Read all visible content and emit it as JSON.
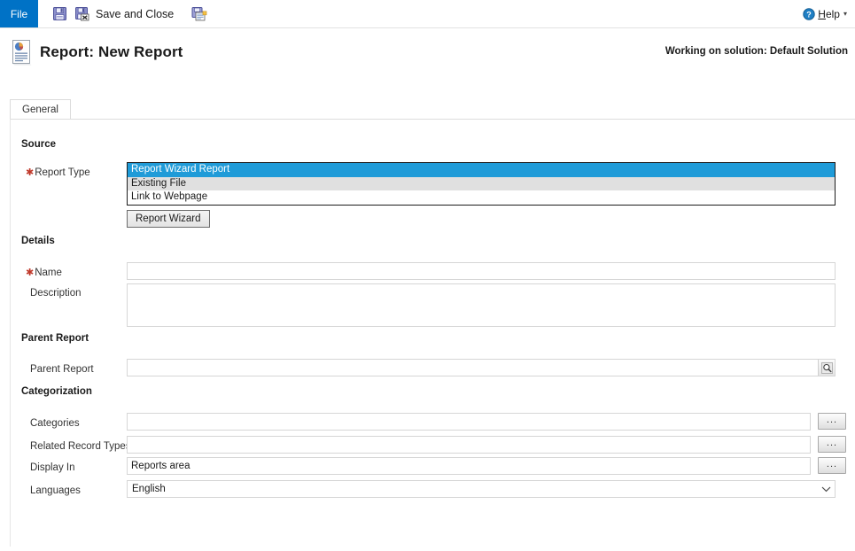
{
  "command_bar": {
    "file_tab": "File",
    "save_icon": "save-floppy-icon",
    "save_close_icon": "save-and-close-icon",
    "save_close_label": "Save and Close",
    "save_new_icon": "save-and-new-icon",
    "help": {
      "icon": "help-question-icon",
      "label_prefix": "H",
      "label_rest": "elp",
      "caret": "▾"
    }
  },
  "header": {
    "icon": "report-document-icon",
    "title": "Report: New Report",
    "solution_note": "Working on solution: Default Solution"
  },
  "tabs": [
    {
      "label": "General",
      "active": true
    }
  ],
  "form": {
    "source": {
      "heading": "Source",
      "report_type": {
        "label": "Report Type",
        "required": true,
        "options": [
          {
            "label": "Report Wizard Report",
            "selected": true
          },
          {
            "label": "Existing File",
            "selected": false
          },
          {
            "label": "Link to Webpage",
            "selected": false
          }
        ]
      },
      "wizard_button": "Report Wizard"
    },
    "details": {
      "heading": "Details",
      "name": {
        "label": "Name",
        "required": true,
        "value": "",
        "placeholder": ""
      },
      "description": {
        "label": "Description",
        "required": false,
        "value": "",
        "placeholder": ""
      }
    },
    "parent_report": {
      "heading": "Parent Report",
      "field": {
        "label": "Parent Report",
        "value": "",
        "placeholder": "",
        "lookup_icon": "lookup-magnifier-icon"
      }
    },
    "categorization": {
      "heading": "Categorization",
      "categories": {
        "label": "Categories",
        "value": "",
        "button": "..."
      },
      "related_record_types": {
        "label": "Related Record Types",
        "value": "",
        "button": "..."
      },
      "display_in": {
        "label": "Display In",
        "value": "Reports area",
        "button": "..."
      },
      "languages": {
        "label": "Languages",
        "value": "English",
        "caret": "chevron-down-icon"
      }
    }
  },
  "colors": {
    "file_tab_blue": "#0072c6",
    "selection_blue": "#1f9bd8",
    "alt_row_gray": "#e0e0e0",
    "required_red": "#c0392b"
  }
}
